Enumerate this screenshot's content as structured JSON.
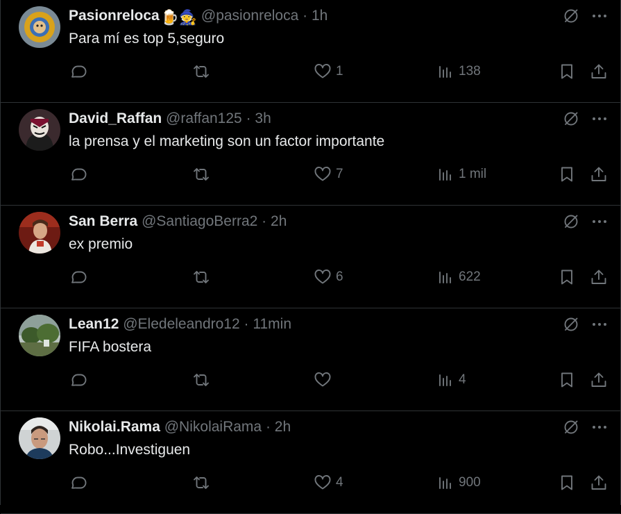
{
  "colors": {
    "background": "#000000",
    "text": "#e7e9ea",
    "muted": "#71767b",
    "border": "#2f3336"
  },
  "icons": {
    "reply": "reply-icon",
    "retweet": "retweet-icon",
    "like": "heart-icon",
    "views": "views-icon",
    "bookmark": "bookmark-icon",
    "share": "share-icon",
    "grok": "grok-icon",
    "more": "more-icon"
  },
  "tweets": [
    {
      "name": "Pasionreloca",
      "name_emojis": "🍺🧙",
      "handle": "@pasionreloca",
      "time": "1h",
      "text": "Para mí es top 5,seguro",
      "likes": "1",
      "views": "138"
    },
    {
      "name": "David_Raffan",
      "name_emojis": "",
      "handle": "@raffan125",
      "time": "3h",
      "text": "la prensa y el marketing son un factor importante",
      "likes": "7",
      "views": "1 mil"
    },
    {
      "name": "San Berra",
      "name_emojis": "",
      "handle": "@SantiagoBerra2",
      "time": "2h",
      "text": "ex premio",
      "likes": "6",
      "views": "622"
    },
    {
      "name": "Lean12",
      "name_emojis": "",
      "handle": "@Eledeleandro12",
      "time": "11min",
      "text": "FIFA bostera",
      "likes": "",
      "views": "4"
    },
    {
      "name": "Nikolai.Rama",
      "name_emojis": "",
      "handle": "@NikolaiRama",
      "time": "2h",
      "text": "Robo...Investiguen",
      "likes": "4",
      "views": "900"
    }
  ],
  "separator": "·"
}
